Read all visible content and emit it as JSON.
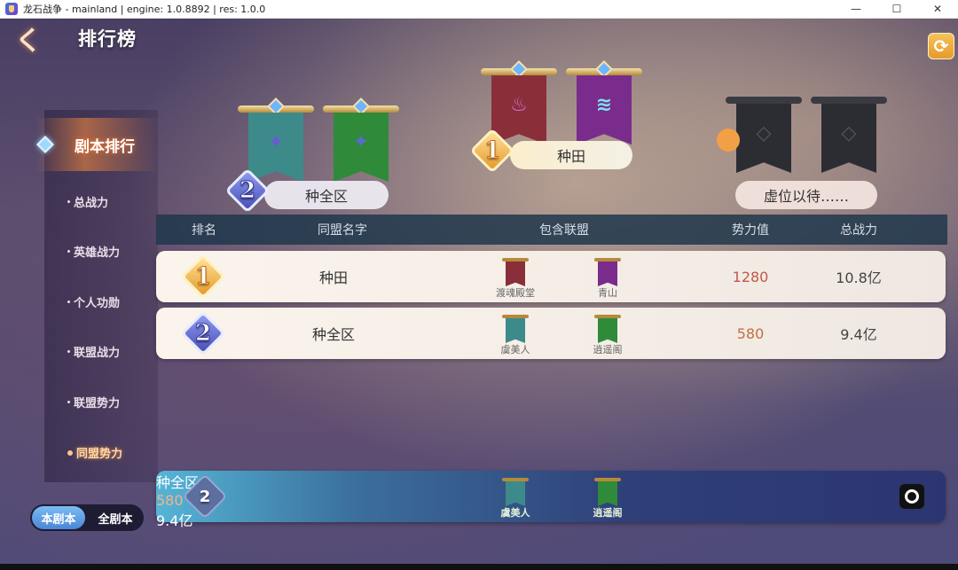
{
  "window": {
    "title": "龙石战争 - mainland | engine: 1.0.8892 | res: 1.0.0",
    "min": "—",
    "max": "☐",
    "close": "✕"
  },
  "header": {
    "title": "排行榜",
    "back_glyph": "く",
    "refresh_glyph": "⟳"
  },
  "menu": {
    "active": "剧本排行",
    "items": [
      "总战力",
      "英雄战力",
      "个人功勋",
      "联盟战力",
      "联盟势力",
      "同盟势力"
    ],
    "selected": "同盟势力"
  },
  "scope_toggle": {
    "options": [
      "本剧本",
      "全剧本"
    ],
    "selected": "本剧本"
  },
  "podium": {
    "first": {
      "rank": "1",
      "name": "种田"
    },
    "second": {
      "rank": "2",
      "name": "种全区"
    },
    "third": {
      "name": "虚位以待……"
    }
  },
  "table": {
    "headers": [
      "排名",
      "同盟名字",
      "包含联盟",
      "势力值",
      "总战力"
    ],
    "rows": [
      {
        "rank": "1",
        "name": "种田",
        "alliances": [
          "渡魂殿堂",
          "青山"
        ],
        "power": "1280",
        "total": "10.8亿",
        "power_color": "#c0574a"
      },
      {
        "rank": "2",
        "name": "种全区",
        "alliances": [
          "虞美人",
          "逍遥阁"
        ],
        "power": "580",
        "total": "9.4亿",
        "power_color": "#c07040"
      }
    ]
  },
  "self_row": {
    "rank": "2",
    "name": "种全区",
    "alliances": [
      "虞美人",
      "逍遥阁"
    ],
    "power": "580",
    "total": "9.4亿"
  },
  "colors": {
    "banner_red": "#8a2f3a",
    "banner_purple": "#7a2c8c",
    "banner_teal": "#3c8a8a",
    "banner_green": "#2f8a3a",
    "banner_dark": "#2c2d33"
  }
}
